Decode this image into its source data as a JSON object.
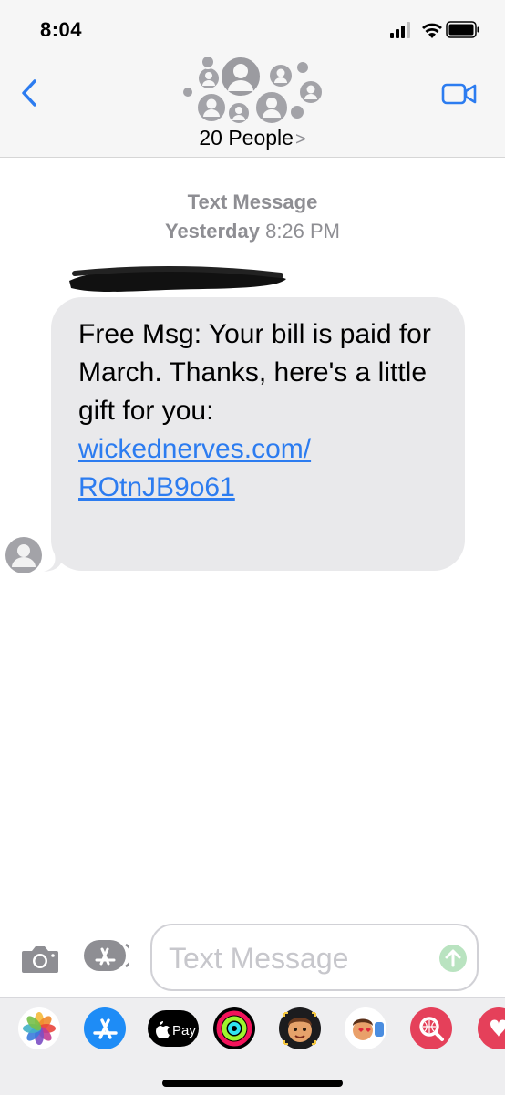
{
  "status_bar": {
    "time": "8:04"
  },
  "header": {
    "group_title": "20 People",
    "chevron": ">"
  },
  "conversation": {
    "message_type": "Text Message",
    "date_label": "Yesterday",
    "time_label": "8:26 PM",
    "sender_redacted": true,
    "message": {
      "text": "Free Msg: Your bill is paid for March. Thanks, here's a little gift for you:",
      "link_line1": "wickednerves.com/",
      "link_line2": "ROtnJB9o61"
    }
  },
  "composer": {
    "placeholder": "Text Message"
  },
  "app_strip": {
    "apple_pay_label": "Pay",
    "apps": [
      "photos-app",
      "app-store-app",
      "apple-pay-app",
      "activity-app",
      "memoji-app",
      "animoji-app",
      "web-images-app",
      "digital-touch-app"
    ]
  },
  "colors": {
    "accent": "#2c7cf0",
    "bubble": "#e9e9eb",
    "meta_gray": "#8e8e93"
  }
}
